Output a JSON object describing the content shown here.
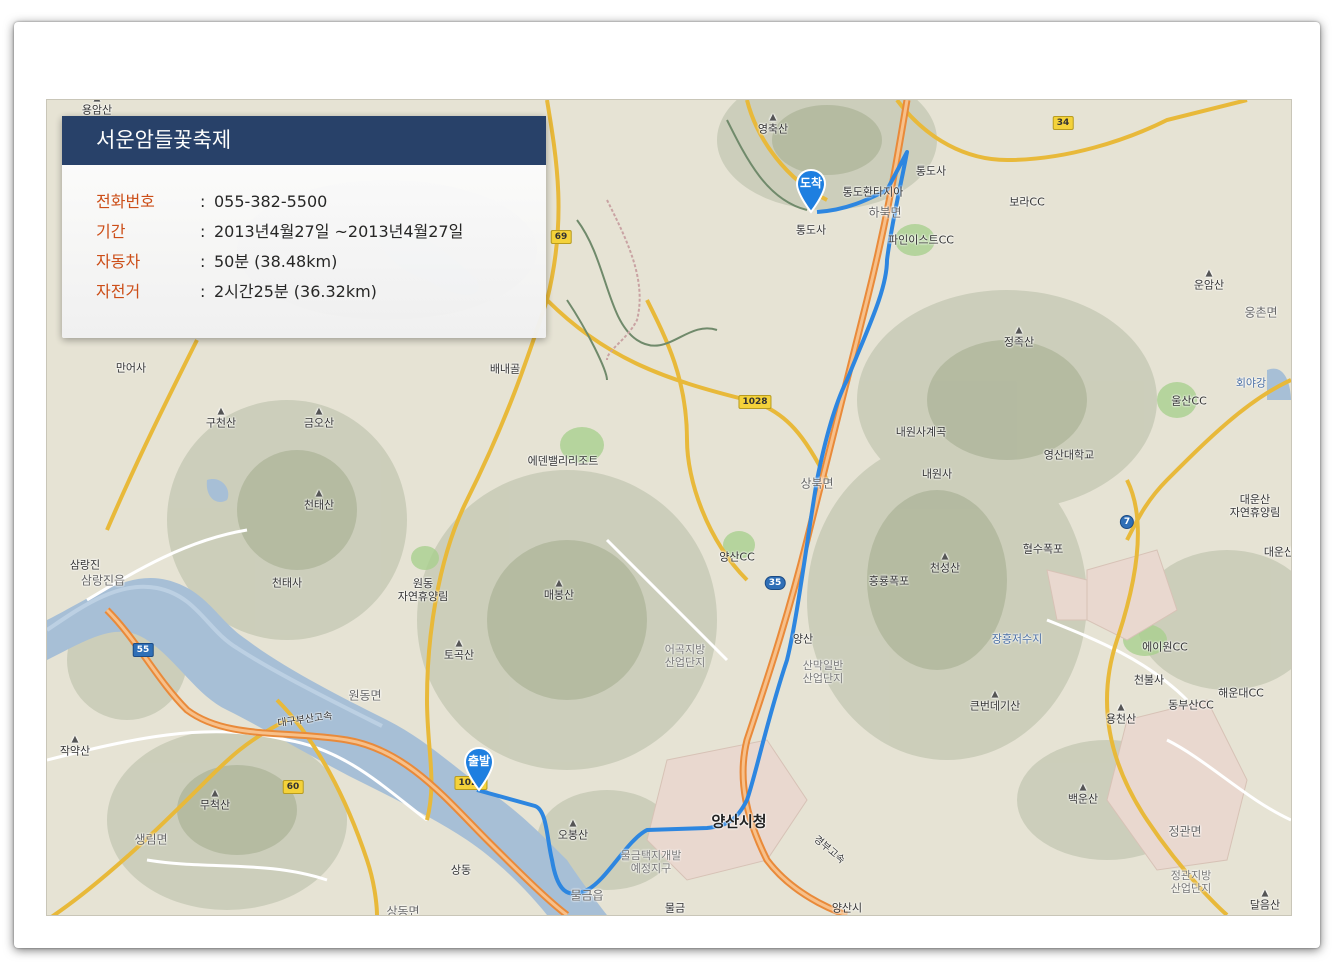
{
  "info_panel": {
    "title": "서운암들꽃축제",
    "rows": [
      {
        "key": "전화번호",
        "value": "055-382-5500"
      },
      {
        "key": "기간",
        "value": "2013년4월27일 ~2013년4월27일"
      },
      {
        "key": "자동차",
        "value": "50분 (38.48km)"
      },
      {
        "key": "자전거",
        "value": "2시간25분 (36.32km)"
      }
    ],
    "separator": ":"
  },
  "markers": {
    "start": "출발",
    "end": "도착"
  },
  "colors": {
    "panel_title_bg": "#223c66",
    "key_text": "#cc4a12",
    "route": "#2d86e0",
    "marker": "#1e7fe0"
  },
  "map_labels": {
    "yongamsan": "용암산",
    "yeongchuksan": "영축산",
    "tongdosa_ic": "통도사",
    "tongdo_hwanda": "통도환타지아",
    "tongdosa": "통도사",
    "habukmyeon": "하북면",
    "boracc": "보라CC",
    "pineeast": "파인이스트CC",
    "unamsan": "운암산",
    "ungchonmyeon": "웅촌면",
    "jeongjoksan": "정족산",
    "manEosa": "만어사",
    "baenaegol": "배내골",
    "ulsancc": "울산CC",
    "hoeyagang": "회야강",
    "gucheonsan": "구천산",
    "geumosan": "금오산",
    "naewonsa_valley": "내원사계곡",
    "naewonsa": "내원사",
    "yeongsan_univ": "영산대학교",
    "eden": "에덴밸리리조트",
    "sangbukmyeon": "상북면",
    "cheontaesan": "천태산",
    "daeunsan": "대운산\n자연휴양림",
    "daeunsan2": "대운산",
    "yangsancc": "양산CC",
    "hyeolsu": "혈수폭포",
    "samnangjin_ic": "삼랑진",
    "samnangjin": "삼랑진읍",
    "cheontaesa": "천태사",
    "wondong_forest": "원동\n자연휴양림",
    "maebongsan": "매봉산",
    "heungnyong": "흥룡폭포",
    "cheonseongsan": "천성산",
    "yangsan_ic": "양산",
    "janghung": "장흥저수지",
    "eowon": "에이원CC",
    "eogok": "어곡지방\n산업단지",
    "sanmak": "산막일반\n산업단지",
    "cheonbulsa": "천불사",
    "haeundae_cc": "해운대CC",
    "tokoksan": "토곡산",
    "wondongmyeon": "원동면",
    "daegu_busan_exp": "대구부산고속",
    "keunbeondae": "큰번데기산",
    "yongcheonsan": "용천산",
    "dongbusan_cc": "동부산CC",
    "jakyaksan": "작약산",
    "baegunsan": "백운산",
    "mucheoksan": "무척산",
    "obongsan": "오봉산",
    "yangsan_city": "양산시청",
    "saengnimmyeon": "생림면",
    "mulgeum_dev": "물금택지개발\n예정지구",
    "jeonggwan": "정관면",
    "jeonggwan_ind": "정관지방\n산업단지",
    "sangdong_ic": "상동",
    "mulgeum_ic": "물금",
    "mulgeumeup": "물금읍",
    "sangdongmyeon": "상동면",
    "yangsan_junction": "양산시",
    "dalumsan": "달음산",
    "gyeongbu_exp": "경부고속"
  },
  "road_numbers": {
    "r69": "69",
    "r34": "34",
    "r1028": "1028",
    "r7": "7",
    "r35": "35",
    "r55": "55",
    "r60": "60",
    "r1022": "1022"
  }
}
